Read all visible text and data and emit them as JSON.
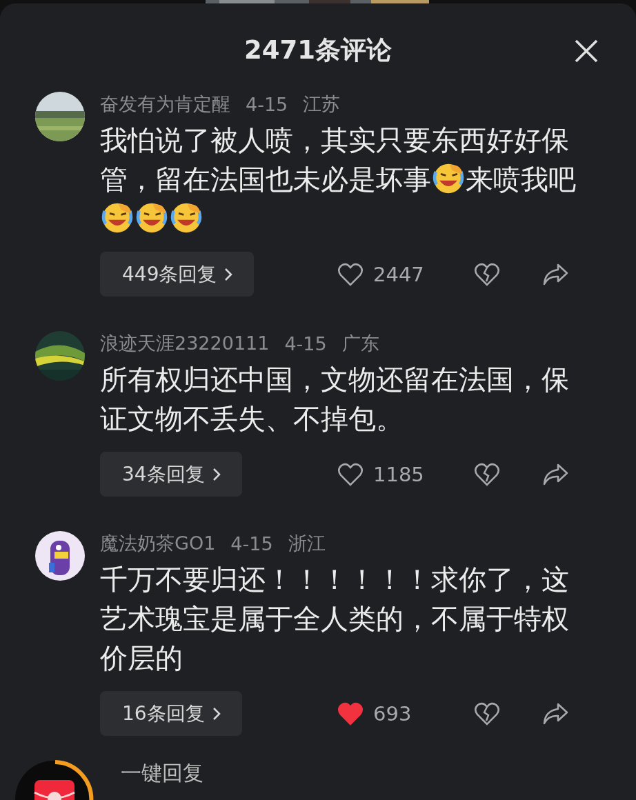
{
  "header": {
    "title": "2471条评论"
  },
  "comments": [
    {
      "author": "奋发有为肯定醒",
      "date": "4-15",
      "region": "江苏",
      "body": [
        {
          "kind": "text",
          "text": "我怕说了被人喷，其实只要东西好好保管，留在法国也未必是坏事"
        },
        {
          "kind": "emoji"
        },
        {
          "kind": "text",
          "text": "来喷我吧"
        },
        {
          "kind": "emoji"
        },
        {
          "kind": "emoji"
        },
        {
          "kind": "emoji"
        }
      ],
      "replies": "449条回复",
      "likes": "2447",
      "liked": false
    },
    {
      "author": "浪迹天涯23220111",
      "date": "4-15",
      "region": "广东",
      "body": [
        {
          "kind": "text",
          "text": "所有权归还中国，文物还留在法国，保证文物不丢失、不掉包。"
        }
      ],
      "replies": "34条回复",
      "likes": "1185",
      "liked": false
    },
    {
      "author": "魔法奶茶GO1",
      "date": "4-15",
      "region": "浙江",
      "body": [
        {
          "kind": "text",
          "text": "千万不要归还！！！！！！求你了，这艺术瑰宝是属于全人类的，不属于特权价层的"
        }
      ],
      "replies": "16条回复",
      "likes": "693",
      "liked": true
    }
  ],
  "footer": {
    "quick_reply": "一键回复"
  }
}
